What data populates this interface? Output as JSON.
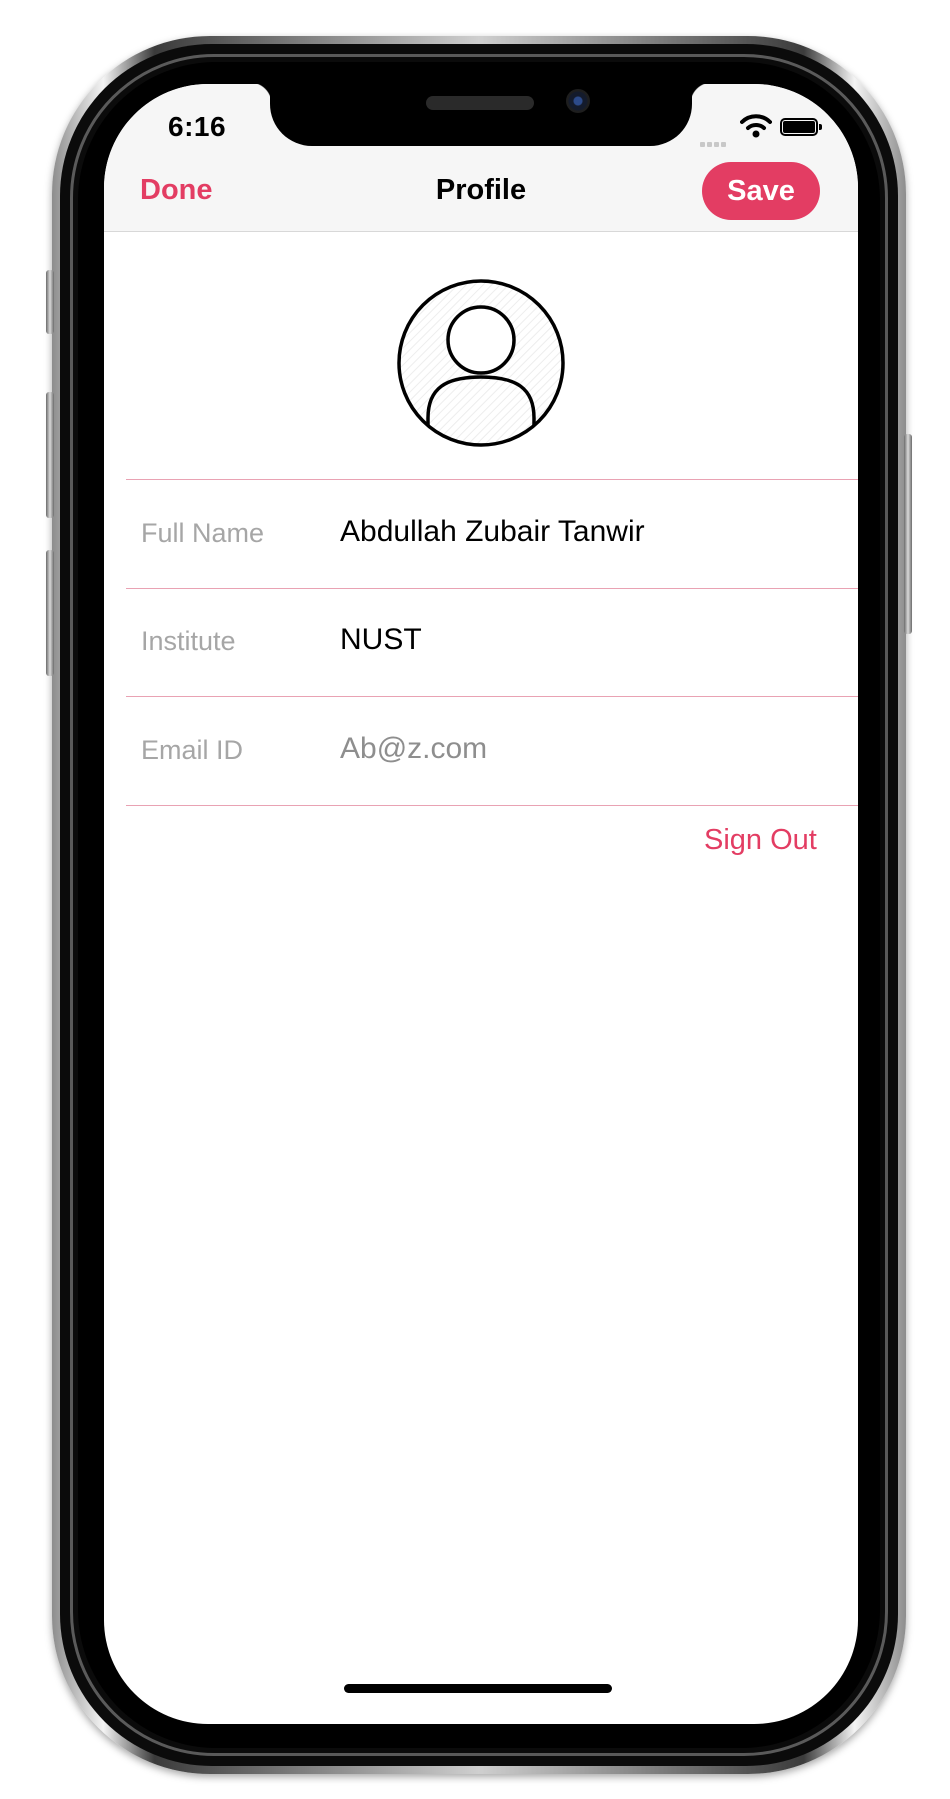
{
  "status_bar": {
    "time": "6:16"
  },
  "nav": {
    "done_label": "Done",
    "title": "Profile",
    "save_label": "Save"
  },
  "avatar": {
    "icon": "person-circle-icon"
  },
  "form": {
    "rows": [
      {
        "label": "Full Name",
        "value": "Abdullah Zubair Tanwir",
        "placeholder": ""
      },
      {
        "label": "Institute",
        "value": "NUST",
        "placeholder": ""
      },
      {
        "label": "Email ID",
        "value": "",
        "placeholder": "Ab@z.com"
      }
    ]
  },
  "sign_out_label": "Sign Out",
  "colors": {
    "accent": "#e33d63",
    "separator": "#e9a2b3",
    "label_gray": "#a6a6a6",
    "nav_background": "#f6f6f6"
  }
}
